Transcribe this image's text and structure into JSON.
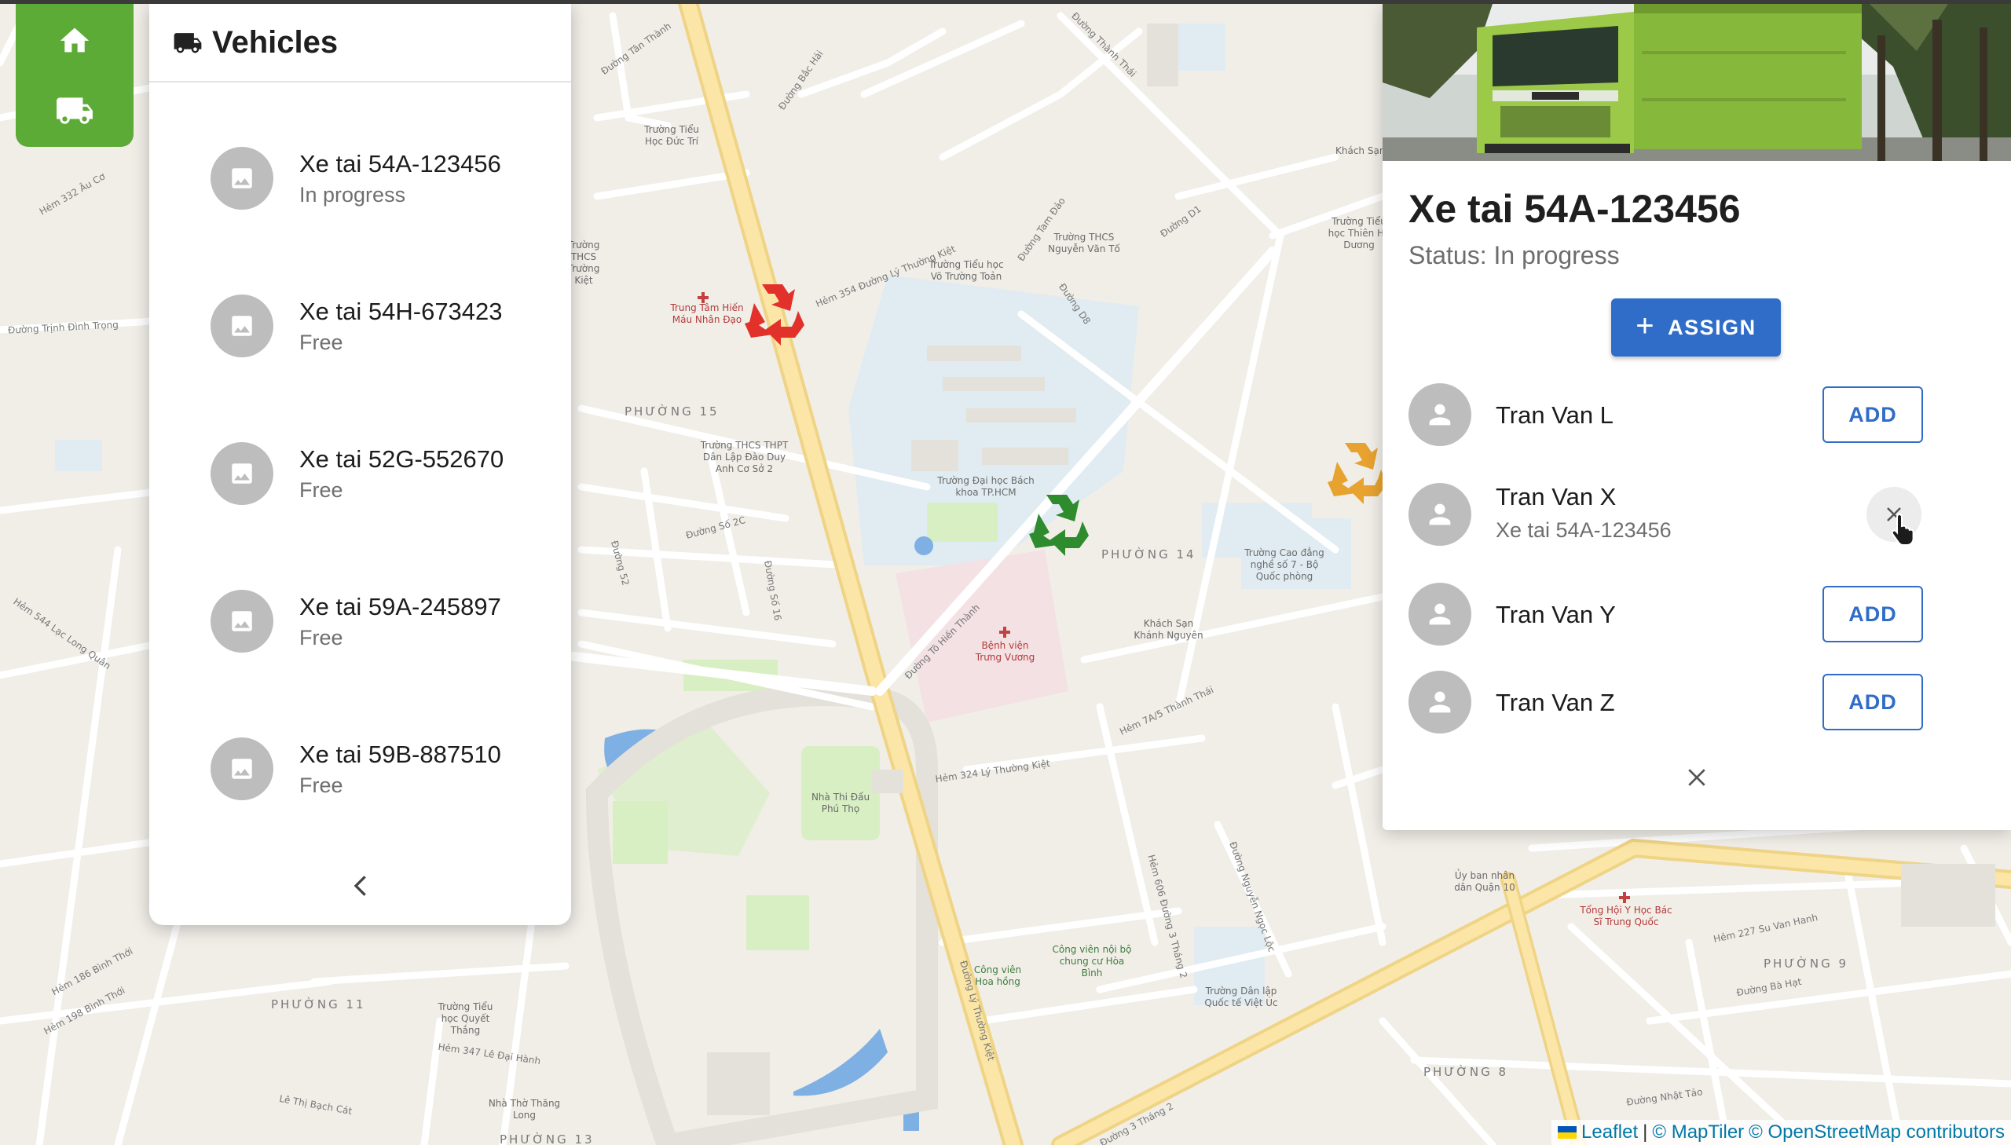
{
  "nav": {
    "home_icon": "home-icon",
    "vehicles_icon": "truck-icon"
  },
  "vehicles_panel": {
    "title": "Vehicles",
    "title_icon": "truck-icon",
    "items": [
      {
        "name": "Xe tai 54A-123456",
        "status": "In progress"
      },
      {
        "name": "Xe tai 54H-673423",
        "status": "Free"
      },
      {
        "name": "Xe tai 52G-552670",
        "status": "Free"
      },
      {
        "name": "Xe tai 59A-245897",
        "status": "Free"
      },
      {
        "name": "Xe tai 59B-887510",
        "status": "Free"
      }
    ],
    "collapse_icon": "chevron-left-icon"
  },
  "detail": {
    "title": "Xe tai 54A-123456",
    "status": "Status: In progress",
    "assign_label": "ASSIGN",
    "drivers": [
      {
        "name": "Tran Van L",
        "action": "ADD"
      },
      {
        "name": "Tran Van X",
        "assigned_to": "Xe tai 54A-123456",
        "action": "remove"
      },
      {
        "name": "Tran Van Y",
        "action": "ADD"
      },
      {
        "name": "Tran Van Z",
        "action": "ADD"
      }
    ],
    "close_icon": "close-icon"
  },
  "map": {
    "wards": [
      "PHƯỜNG 15",
      "PHƯỜNG 14",
      "PHƯỜNG 11",
      "PHƯỜNG 9",
      "PHƯỜNG 8",
      "PHƯỜNG 13"
    ],
    "streets": [
      "Đường Trịnh Đình Trọng",
      "Hẻm 354 Đường Lý Thường Kiệt",
      "Đường Thành Thái",
      "Hẻm 324 Lý Thường Kiệt",
      "Đường Tô Hiến Thành",
      "Đường 3 Tháng 2",
      "Đường Lý Thường Kiệt",
      "Hẻm 347 Lê Đại Hành",
      "Lê Thị Bạch Cát",
      "Đường Tân Thành",
      "Đường Bắc Hải",
      "Đường D1",
      "Đường D8",
      "Đường Tam Đảo",
      "Đường Số 2C",
      "Hẻm 7A/5 Thành Thái",
      "Hẻm 227 Su Van Hanh",
      "Đường Bà Hạt",
      "Đường Nhật Tảo",
      "Đường Nguyễn Ngọc Lộc",
      "Hẻm 606 Đường 3 Tháng 2",
      "Đường Số 16",
      "Đường 52",
      "Hẻm 332 Âu Cơ",
      "Hẻm 544 Lạc Long Quân",
      "Hẻm 186 Bình Thới",
      "Hẻm 198 Bình Thới"
    ],
    "pois": [
      "Trường Tiểu Học Đức Trí",
      "Trung Tâm Hiến Máu Nhân Đạo",
      "Trường THCS THPT Dân Lập Đào Duy Anh Cơ Sở 2",
      "Trường Đại học Bách khoa TP.HCM",
      "Trường Tiểu học Võ Trường Toản",
      "Trường THCS Nguyễn Văn Tố",
      "Bệnh viện Trưng Vương",
      "Khách Sạn Khánh Nguyên",
      "Trường Cao đẳng nghề số 7 - Bộ Quốc phòng",
      "Nhà Thi Đấu Phú Thọ",
      "Công viên Hoa hồng",
      "Công viên nội bộ chung cư Hòa Bình",
      "Trường Dân lập Quốc tế Việt Úc",
      "Ủy ban nhân dân Quận 10",
      "Tổng Hội Y Học Bác Sĩ Trung Quốc",
      "Trường Tiểu học Quyết Thắng",
      "Nhà Thờ Thăng Long",
      "Trường Tiểu học Thiên Hộ Dương",
      "Trường THCS Trường Kiệt",
      "Khách Sạn"
    ]
  },
  "attribution": {
    "leaflet": "Leaflet",
    "separator": "|",
    "maptiler": "© MapTiler",
    "osm": "© OpenStreetMap contributors"
  },
  "colors": {
    "nav_green": "#5cab36",
    "primary_blue": "#2f6dc8",
    "avatar_gray": "#bdbdbd",
    "recycle_red": "#e2312a",
    "recycle_green": "#2e8b2e",
    "recycle_orange": "#e7a230"
  }
}
